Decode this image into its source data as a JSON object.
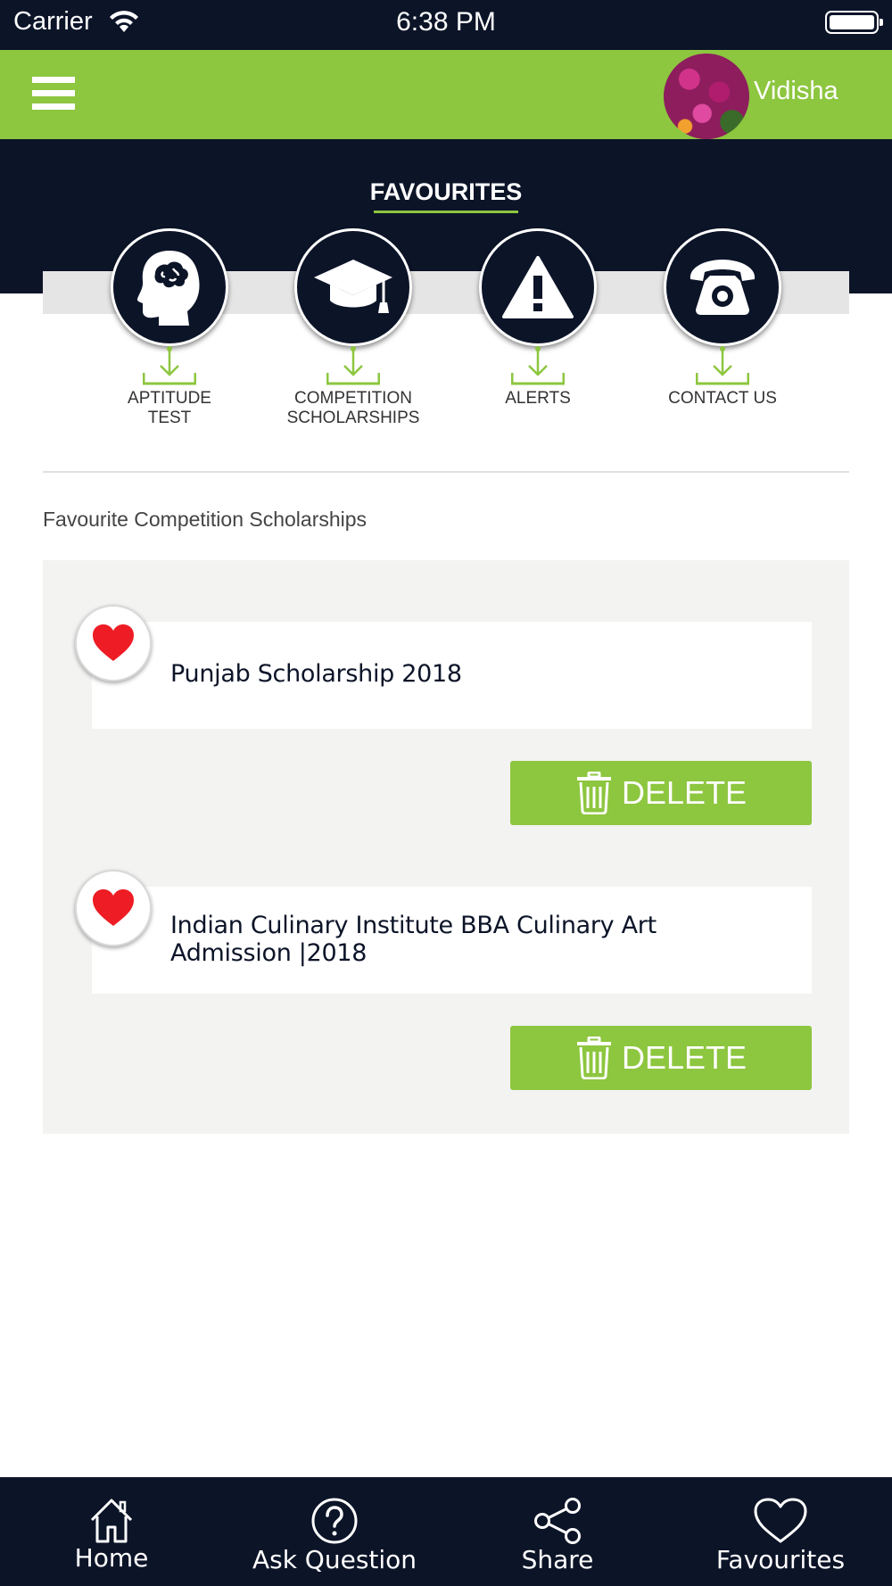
{
  "status_bar": {
    "carrier": "Carrier",
    "time": "6:38 PM"
  },
  "header": {
    "user_name": "Vidisha"
  },
  "page": {
    "title": "FAVOURITES"
  },
  "categories": [
    {
      "label": "APTITUDE\nTEST",
      "icon": "brain-head-icon"
    },
    {
      "label": "COMPETITION\nSCHOLARSHIPS",
      "icon": "graduation-cap-icon"
    },
    {
      "label": "ALERTS",
      "icon": "warning-icon"
    },
    {
      "label": "CONTACT US",
      "icon": "telephone-icon"
    }
  ],
  "section": {
    "title": "Favourite Competition Scholarships"
  },
  "favourites": [
    {
      "title": "Punjab Scholarship 2018",
      "delete_label": "DELETE"
    },
    {
      "title": "Indian Culinary Institute BBA Culinary Art Admission |2018",
      "delete_label": "DELETE"
    }
  ],
  "tab_bar": [
    {
      "label": "Home",
      "icon": "home-icon"
    },
    {
      "label": "Ask Question",
      "icon": "question-icon"
    },
    {
      "label": "Share",
      "icon": "share-icon"
    },
    {
      "label": "Favourites",
      "icon": "heart-outline-icon"
    }
  ],
  "colors": {
    "accent": "#8dc63f",
    "navy": "#0c1428",
    "heart": "#ee1c24"
  }
}
